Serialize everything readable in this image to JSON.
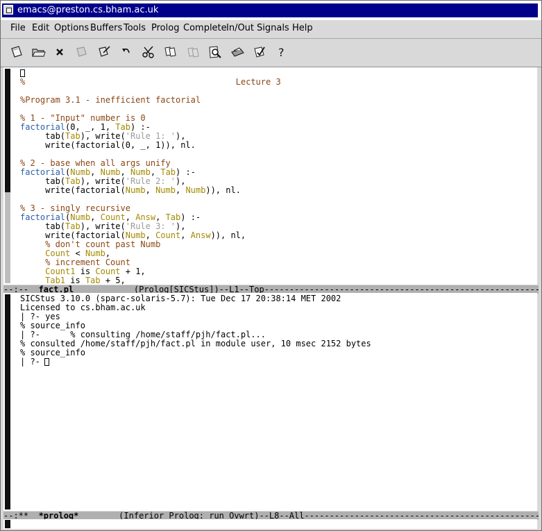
{
  "window": {
    "title": "emacs@preston.cs.bham.ac.uk"
  },
  "menubar": {
    "items": [
      "File",
      "Edit",
      "Options",
      "Buffers",
      "Tools",
      "Prolog",
      "Complete",
      "In/Out",
      "Signals",
      "Help"
    ]
  },
  "toolbar": {
    "icons": [
      "open-file-icon",
      "open-directory-icon",
      "close-icon",
      "save-icon",
      "save-as-icon",
      "undo-icon",
      "cut-icon",
      "copy-icon",
      "paste-icon",
      "search-icon",
      "print-icon",
      "customize-icon",
      "help-icon"
    ]
  },
  "editor": {
    "lines": [
      "%                                          Lecture 3",
      "",
      "%Program 3.1 - inefficient factorial",
      "",
      "% 1 - \"Input\" number is 0",
      "factorial(0, _, 1, Tab) :-",
      "     tab(Tab), write('Rule 1: '),",
      "     write(factorial(0, _, 1)), nl.",
      "",
      "% 2 - base when all args unify",
      "factorial(Numb, Numb, Numb, Tab) :-",
      "     tab(Tab), write('Rule 2: '),",
      "     write(factorial(Numb, Numb, Numb)), nl.",
      "",
      "% 3 - singly recursive",
      "factorial(Numb, Count, Answ, Tab) :-",
      "     tab(Tab), write('Rule 3: '),",
      "     write(factorial(Numb, Count, Answ)), nl,",
      "     % don't count past Numb",
      "     Count < Numb,",
      "     % increment Count",
      "     Count1 is Count + 1,",
      "     Tab1 is Tab + 5,"
    ]
  },
  "modeline_top": {
    "prefix": "--:--  ",
    "buffer": "fact.pl",
    "rest": "            (Prolog[SICStus])--L1--Top-----------------------------------------------------------------------"
  },
  "prolog": {
    "lines": [
      "SICStus 3.10.0 (sparc-solaris-5.7): Tue Dec 17 20:38:14 MET 2002",
      "Licensed to cs.bham.ac.uk",
      "| ?- yes",
      "% source_info",
      "| ?-      % consulting /home/staff/pjh/fact.pl...",
      "% consulted /home/staff/pjh/fact.pl in module user, 10 msec 2152 bytes",
      "% source_info",
      "| ?- "
    ]
  },
  "modeline_bottom": {
    "prefix": "--:**  ",
    "buffer": "*prolog*",
    "rest": "        (Inferior Prolog: run Ovwrt)--L8--All-----------------------------------------------------------"
  }
}
